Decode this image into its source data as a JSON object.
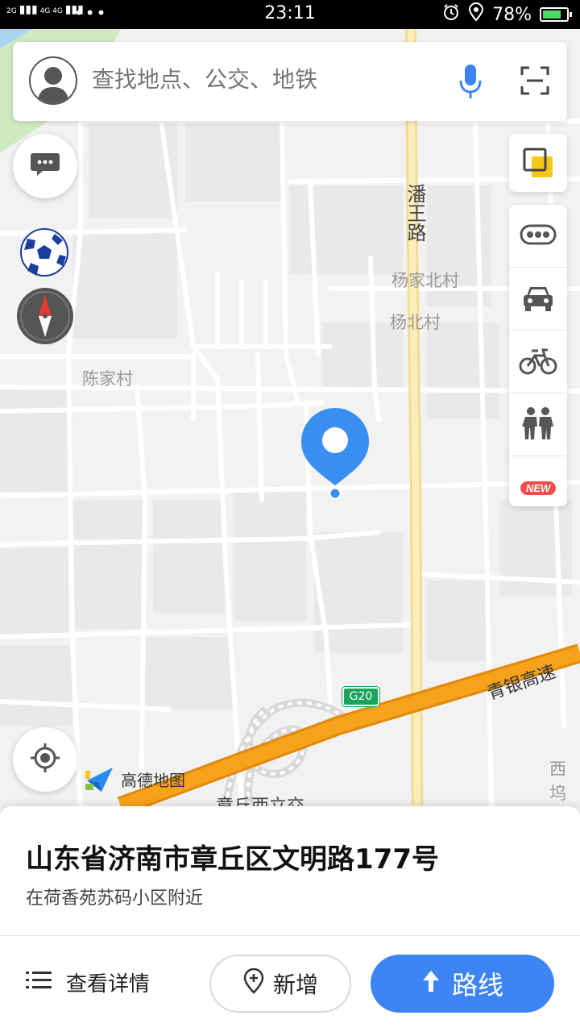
{
  "status_bar": {
    "signal_left": "2G",
    "signal_right": "4G 4G",
    "dots": "•••",
    "time": "23:11",
    "battery": "78%",
    "battery_level": 0.78
  },
  "search": {
    "placeholder": "查找地点、公交、地铁"
  },
  "map": {
    "road_name": "潘王路",
    "villages": [
      "杨家北村",
      "杨北村",
      "陈家村"
    ],
    "highway_name": "青银高速",
    "highway_code": "G20",
    "interchange": "章丘西立交",
    "edge_label": "西坞",
    "brand": "高德地图"
  },
  "side_tools": [
    "traffic-icon",
    "taxi-icon",
    "bike-icon",
    "walk-icon",
    "new-badge"
  ],
  "new_badge": "NEW",
  "place": {
    "address": "山东省济南市章丘区文明路177号",
    "nearby": "在荷香苑苏码小区附近"
  },
  "actions": {
    "details": "查看详情",
    "add": "新增",
    "route": "路线"
  },
  "colors": {
    "accent_blue": "#3d85f5",
    "pin_blue": "#3c8ff2",
    "highway_orange": "#f7a21b",
    "road_yellow": "#f8e7a8"
  }
}
